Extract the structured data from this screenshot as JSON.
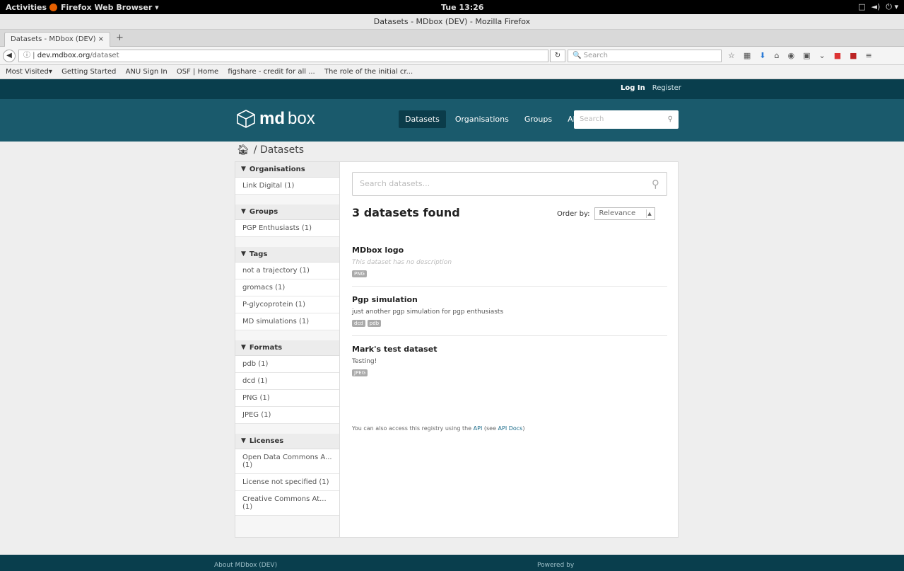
{
  "os": {
    "activities": "Activities",
    "app_name": "Firefox Web Browser ▾",
    "clock": "Tue 13:26",
    "tray": [
      "□",
      "◄)",
      "⏻ ▾"
    ]
  },
  "browser": {
    "window_title": "Datasets - MDbox (DEV) - Mozilla Firefox",
    "tab_title": "Datasets - MDbox (DEV)",
    "tab_close": "×",
    "new_tab": "+",
    "url_host": "dev.mdbox.org",
    "url_path": "/dataset",
    "search_placeholder": "Search",
    "bookmarks": [
      "Most Visited▾",
      "Getting Started",
      "ANU Sign In",
      "OSF | Home",
      "figshare - credit for all ...",
      "The role of the initial cr..."
    ]
  },
  "site": {
    "account_links": {
      "login": "Log In",
      "register": "Register"
    },
    "logo_md": "md",
    "logo_box": "box",
    "nav": [
      {
        "label": "Datasets",
        "active": true
      },
      {
        "label": "Organisations",
        "active": false
      },
      {
        "label": "Groups",
        "active": false
      },
      {
        "label": "About",
        "active": false
      }
    ],
    "site_search_placeholder": "Search",
    "breadcrumb": "/ Datasets"
  },
  "facets": [
    {
      "title": "Organisations",
      "items": [
        "Link Digital (1)"
      ]
    },
    {
      "title": "Groups",
      "items": [
        "PGP Enthusiasts (1)"
      ]
    },
    {
      "title": "Tags",
      "items": [
        "not a trajectory (1)",
        "gromacs (1)",
        "P-glycoprotein (1)",
        "MD simulations (1)"
      ]
    },
    {
      "title": "Formats",
      "items": [
        "pdb (1)",
        "dcd (1)",
        "PNG (1)",
        "JPEG (1)"
      ]
    },
    {
      "title": "Licenses",
      "items": [
        "Open Data Commons A... (1)",
        "License not specified (1)",
        "Creative Commons At... (1)"
      ]
    }
  ],
  "main": {
    "search_placeholder": "Search datasets...",
    "results_title": "3 datasets found",
    "order_by_label": "Order by:",
    "order_by_value": "Relevance",
    "datasets": [
      {
        "title": "MDbox logo",
        "description": "This dataset has no description",
        "empty": true,
        "formats": [
          "PNG"
        ]
      },
      {
        "title": "Pgp simulation",
        "description": "just another pgp simulation for pgp enthusiasts",
        "empty": false,
        "formats": [
          "dcd",
          "pdb"
        ]
      },
      {
        "title": "Mark's test dataset",
        "description": "Testing!",
        "empty": false,
        "formats": [
          "JPEG"
        ]
      }
    ],
    "api_note_prefix": "You can also access this registry using the ",
    "api_link": "API",
    "api_note_mid": " (see ",
    "api_docs_link": "API Docs",
    "api_note_suffix": ")"
  },
  "footer": {
    "left": "About MDbox (DEV)",
    "right": "Powered by"
  }
}
